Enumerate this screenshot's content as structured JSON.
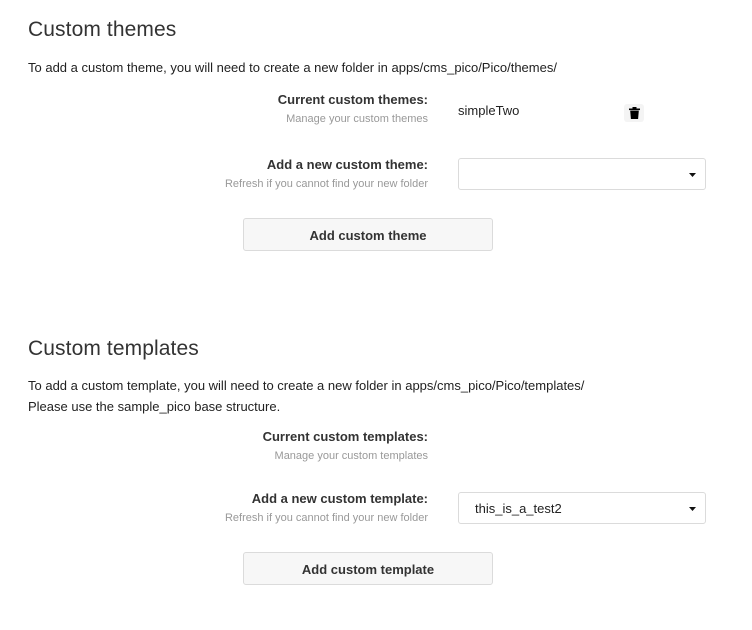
{
  "themes": {
    "title": "Custom themes",
    "description": "To add a custom theme, you will need to create a new folder in apps/cms_pico/Pico/themes/",
    "current_label": "Current custom themes:",
    "current_hint": "Manage your custom themes",
    "current_items": [
      "simpleTwo"
    ],
    "delete_icon": "trash-icon",
    "add_label": "Add a new custom theme:",
    "add_hint": "Refresh if you cannot find your new folder",
    "select_value": "",
    "button_label": "Add custom theme"
  },
  "templates": {
    "title": "Custom templates",
    "description_line1": "To add a custom template, you will need to create a new folder in apps/cms_pico/Pico/templates/",
    "description_line2": "Please use the sample_pico base structure.",
    "current_label": "Current custom templates:",
    "current_hint": "Manage your custom templates",
    "add_label": "Add a new custom template:",
    "add_hint": "Refresh if you cannot find your new folder",
    "select_value": "this_is_a_test2",
    "button_label": "Add custom template"
  },
  "colors": {
    "heading": "#333333",
    "hint": "#999999",
    "border": "#dbdbdb",
    "button_bg": "#f7f7f7"
  }
}
